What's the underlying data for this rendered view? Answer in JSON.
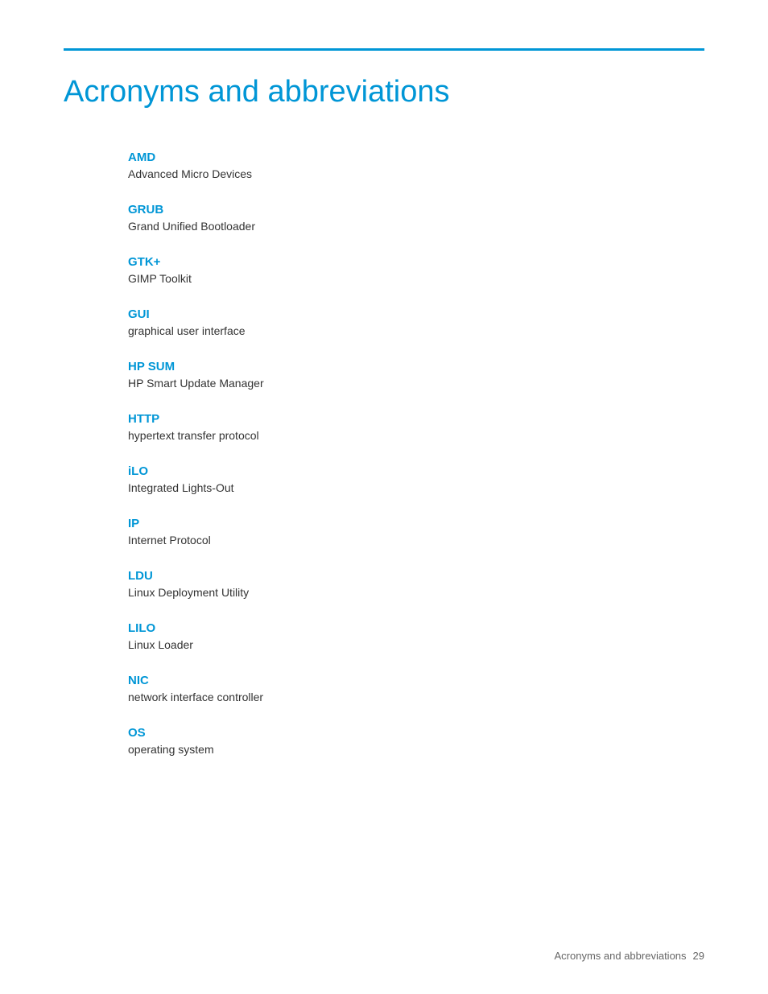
{
  "page": {
    "title": "Acronyms and abbreviations",
    "accent_color": "#0096d6"
  },
  "acronyms": [
    {
      "term": "AMD",
      "definition": "Advanced Micro Devices"
    },
    {
      "term": "GRUB",
      "definition": "Grand Unified Bootloader"
    },
    {
      "term": "GTK+",
      "definition": "GIMP Toolkit"
    },
    {
      "term": "GUI",
      "definition": "graphical user interface"
    },
    {
      "term": "HP SUM",
      "definition": "HP Smart Update Manager"
    },
    {
      "term": "HTTP",
      "definition": "hypertext transfer protocol"
    },
    {
      "term": "iLO",
      "definition": "Integrated Lights-Out"
    },
    {
      "term": "IP",
      "definition": "Internet Protocol"
    },
    {
      "term": "LDU",
      "definition": "Linux Deployment Utility"
    },
    {
      "term": "LILO",
      "definition": "Linux Loader"
    },
    {
      "term": "NIC",
      "definition": "network interface controller"
    },
    {
      "term": "OS",
      "definition": "operating system"
    }
  ],
  "footer": {
    "text": "Acronyms and abbreviations",
    "page_number": "29"
  }
}
